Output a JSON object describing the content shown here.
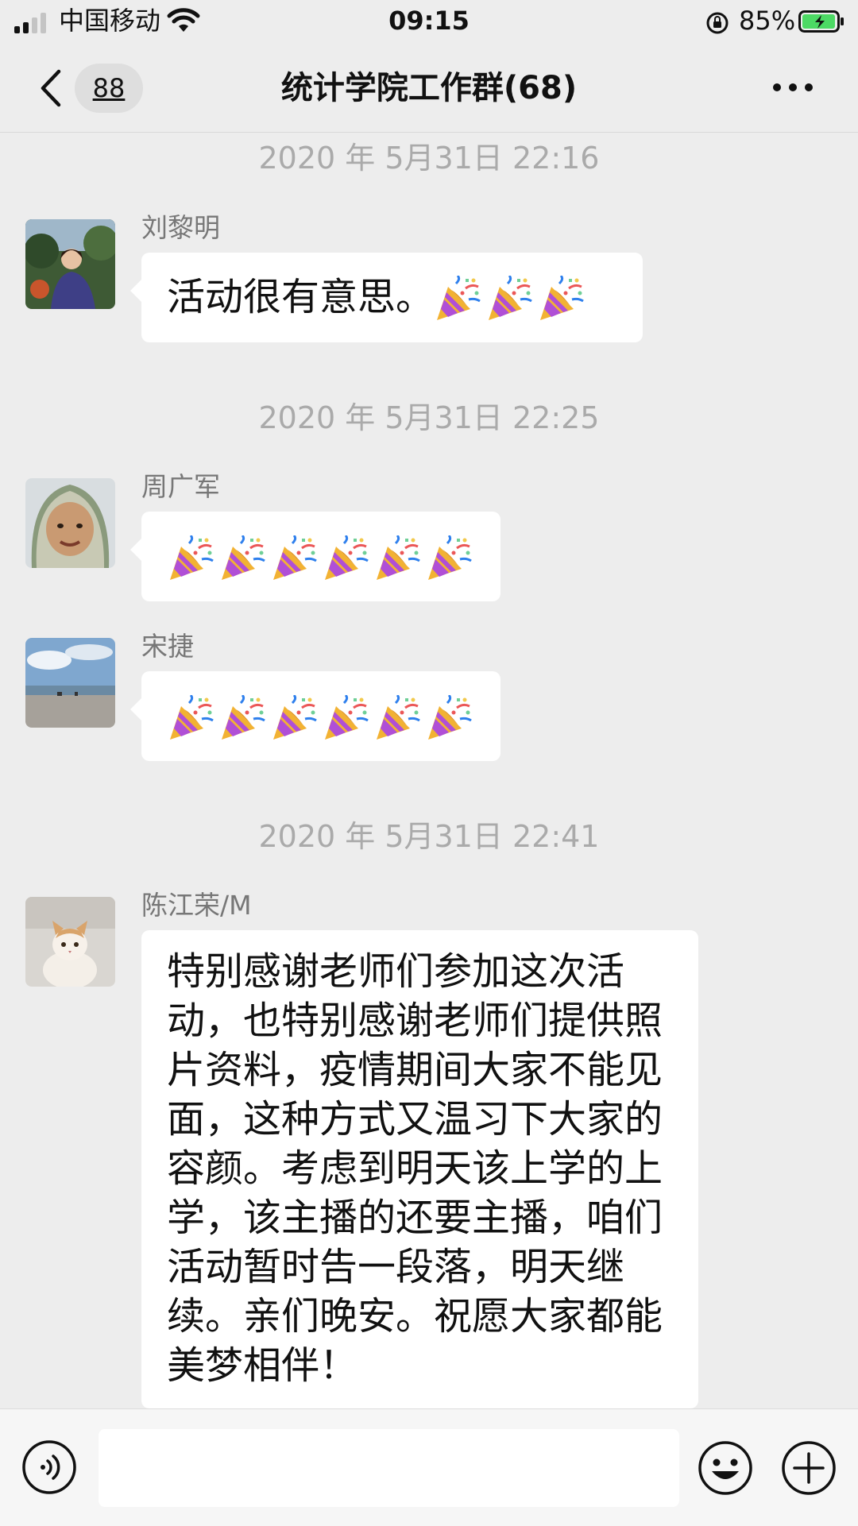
{
  "status_bar": {
    "carrier": "中国移动",
    "time": "09:15",
    "battery": "85%"
  },
  "nav": {
    "unread_count": "88",
    "title": "统计学院工作群(68)"
  },
  "messages": [
    {
      "timestamp": "2020 年 5月31日 22:16",
      "sender": "刘黎明",
      "text": "活动很有意思。",
      "emoji_count": 3
    },
    {
      "timestamp": "2020 年 5月31日 22:25",
      "sender": "周广军",
      "text": "",
      "emoji_count": 6
    },
    {
      "sender": "宋捷",
      "text": "",
      "emoji_count": 6
    },
    {
      "timestamp": "2020 年 5月31日 22:41",
      "sender": "陈江荣/M",
      "text": "特别感谢老师们参加这次活动，也特别感谢老师们提供照片资料，疫情期间大家不能见面，这种方式又温习下大家的容颜。考虑到明天该上学的上学，该主播的还要主播，咱们活动暂时告一段落，明天继续。亲们晚安。祝愿大家都能美梦相伴！"
    }
  ],
  "icons": {
    "emoji": "party-popper-icon",
    "back": "chevron-left-icon",
    "more": "more-dots-icon",
    "voice": "voice-icon",
    "sticker": "smiley-icon",
    "add": "plus-circle-icon"
  },
  "colors": {
    "background": "#ededed",
    "bubble": "#ffffff",
    "timestamp": "#aaaaaa",
    "battery_fill": "#4cd964"
  }
}
